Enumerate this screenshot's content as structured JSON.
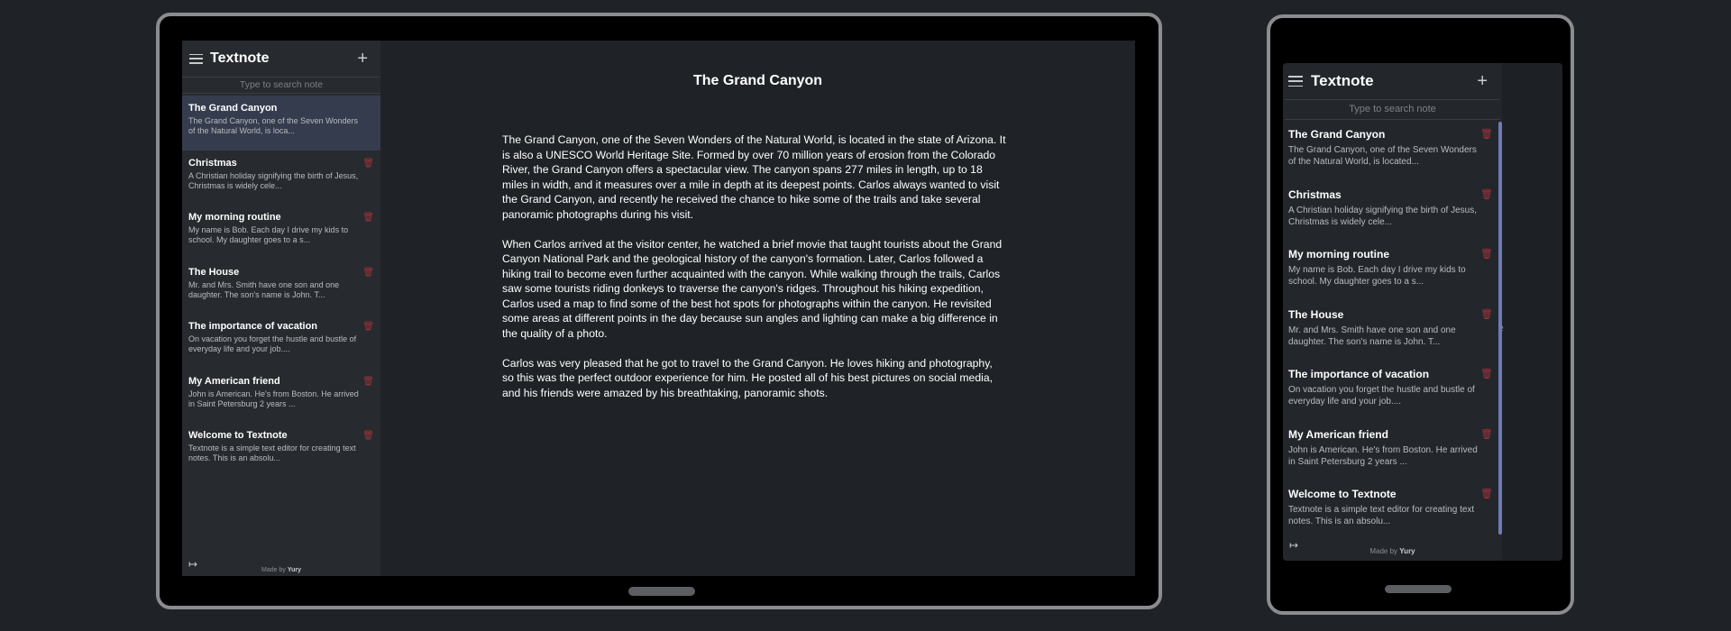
{
  "app": {
    "title": "Textnote",
    "add_label": "+",
    "search_placeholder": "Type to search note",
    "made_by_prefix": "Made by",
    "made_by_name": "Yury"
  },
  "notes": [
    {
      "title": "The Grand Canyon",
      "excerpt": "The Grand Canyon, one of the Seven Wonders of the Natural World, is loca...",
      "excerpt_phone": "The Grand Canyon, one of the Seven Wonders of the Natural World, is located..."
    },
    {
      "title": "Christmas",
      "excerpt": "A Christian holiday signifying the birth of Jesus, Christmas is widely cele...",
      "excerpt_phone": "A Christian holiday signifying the birth of Jesus, Christmas is widely cele..."
    },
    {
      "title": "My morning routine",
      "excerpt": "My name is Bob. Each day I drive my kids to school. My daughter goes to a s...",
      "excerpt_phone": "My name is Bob. Each day I drive my kids to school. My daughter goes to a s..."
    },
    {
      "title": "The House",
      "excerpt": "Mr. and Mrs. Smith have one son and one daughter. The son's name is John. T...",
      "excerpt_phone": "Mr. and Mrs. Smith have one son and one daughter. The son's name is John. T..."
    },
    {
      "title": "The importance of vacation",
      "excerpt": "On vacation you forget the hustle and bustle of everyday life and your job....",
      "excerpt_phone": "On vacation you forget the hustle and bustle of everyday life and your job...."
    },
    {
      "title": "My American friend",
      "excerpt": "John is American. He's from Boston. He arrived in Saint Petersburg 2 years ...",
      "excerpt_phone": "John is American. He's from Boston. He arrived in Saint Petersburg 2 years ..."
    },
    {
      "title": "Welcome to Textnote",
      "excerpt": "Textnote is a simple text editor for creating text notes. This is an absolu...",
      "excerpt_phone": "Textnote is a simple text editor for creating text notes. This is an absolu..."
    }
  ],
  "editor": {
    "title": "The Grand Canyon",
    "paragraphs": [
      "The Grand Canyon, one of the Seven Wonders of the Natural World, is located in the state of Arizona. It is also a UNESCO World Heritage Site. Formed by over 70 million years of erosion from the Colorado River, the Grand Canyon offers a spectacular view. The canyon spans 277 miles in length, up to 18 miles in width, and it measures over a mile in depth at its deepest points. Carlos always wanted to visit the Grand Canyon, and recently he received the chance to hike some of the trails and take several panoramic photographs during his visit.",
      "When Carlos arrived at the visitor center, he watched a brief movie that taught tourists about the Grand Canyon National Park and the geological history of the canyon's formation. Later, Carlos followed a hiking trail to become even further acquainted with the canyon. While walking through the trails, Carlos saw some tourists riding donkeys to traverse the canyon's ridges. Throughout his hiking expedition, Carlos used a map to find some of the best hot spots for photographs within the canyon. He revisited some areas at different points in the day because sun angles and lighting can make a big difference in the quality of a photo.",
      "Carlos was very pleased that he got to travel to the Grand Canyon. He loves hiking and photography, so this was the perfect outdoor experience for him. He posted all of his best pictures on social media, and his friends were amazed by his breathtaking, panoramic shots."
    ]
  },
  "phone_background_glyph": "e",
  "colors": {
    "active_note": "#353c4e",
    "trash": "#a3323a",
    "scrollbar": "#6e7bb5",
    "background": "#1f2327"
  },
  "icons": {
    "menu": "hamburger-icon",
    "add": "plus-icon",
    "delete": "trash-icon",
    "logout": "logout-icon"
  }
}
